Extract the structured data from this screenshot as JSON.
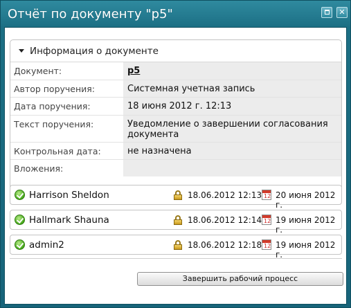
{
  "window": {
    "title": "Отчёт по документу \"p5\"",
    "maximize_glyph": "",
    "close_glyph": "✕"
  },
  "info": {
    "section_title": "Информация о документе",
    "rows": [
      {
        "label": "Документ:",
        "value": "p5"
      },
      {
        "label": "Автор поручения:",
        "value": "Системная учетная запись"
      },
      {
        "label": "Дата поручения:",
        "value": "18 июня 2012 г. 12:13"
      },
      {
        "label": "Текст поручения:",
        "value": "Уведомление о завершении согласования документа"
      },
      {
        "label": "Контрольная дата:",
        "value": "не назначена"
      },
      {
        "label": "Вложения:",
        "value": ""
      }
    ]
  },
  "tasks": [
    {
      "name": "Harrison Sheldon",
      "datetime": "18.06.2012 12:13",
      "due": "20 июня 2012 г.",
      "cal_day": "12"
    },
    {
      "name": "Hallmark Shauna",
      "datetime": "18.06.2012 12:14",
      "due": "19 июня 2012 г.",
      "cal_day": "12"
    },
    {
      "name": "admin2",
      "datetime": "18.06.2012 12:18",
      "due": "19 июня 2012 г.",
      "cal_day": "12"
    }
  ],
  "actions": {
    "finish_label": "Завершить рабочий процесс"
  },
  "icons": {
    "status": "check-circle-icon",
    "lock": "lock-icon",
    "calendar": "calendar-icon",
    "collapse": "triangle-down-icon"
  },
  "colors": {
    "title_bar": "#1c6f84",
    "value_bg": "#ececec",
    "check": "#47a91b"
  }
}
